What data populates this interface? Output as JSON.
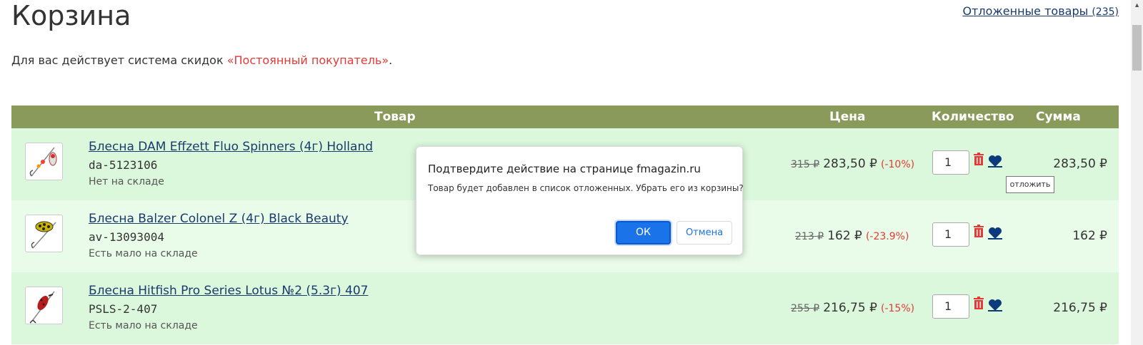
{
  "page": {
    "title": "Корзина",
    "saved_link_label": "Отложенные товары",
    "saved_link_count": "(235)",
    "discount_prefix": "Для вас действует система скидок ",
    "discount_name": "«Постоянный покупатель»",
    "discount_suffix": "."
  },
  "table": {
    "col_product": "Товар",
    "col_price": "Цена",
    "col_quantity": "Количество",
    "col_sum": "Сумма",
    "rows": [
      {
        "name": "Блесна DAM Effzett Fluo Spinners (4г) Holland",
        "code": "da-5123106",
        "stock": "Нет на складе",
        "old_price": "315 ₽",
        "price": "283,50 ₽",
        "discount": "(-10%)",
        "qty": "1",
        "sum": "283,50 ₽"
      },
      {
        "name": "Блесна Balzer Colonel Z (4г) Black Beauty",
        "code": "av-13093004",
        "stock": "Есть мало на складе",
        "old_price": "213 ₽",
        "price": "162 ₽",
        "discount": "(-23.9%)",
        "qty": "1",
        "sum": "162 ₽"
      },
      {
        "name": "Блесна Hitfish Pro Series Lotus №2 (5.3г) 407",
        "code": "PSLS-2-407",
        "stock": "Есть мало на складе",
        "old_price": "255 ₽",
        "price": "216,75 ₽",
        "discount": "(-15%)",
        "qty": "1",
        "sum": "216,75 ₽"
      }
    ]
  },
  "tooltip": {
    "text": "отложить"
  },
  "dialog": {
    "title": "Подтвердите действие на странице fmagazin.ru",
    "message": "Товар будет добавлен в список отложенных. Убрать его из корзины?",
    "ok_label": "ОК",
    "cancel_label": "Отмена"
  },
  "colors": {
    "header_bg": "#8a9a5b",
    "row_bg": "#dcf8dc",
    "accent_red": "#e53935",
    "link_blue": "#1a3a6e",
    "dialog_button": "#1a73e8"
  },
  "icons": {
    "delete": "trash-icon",
    "save_for_later": "heart-icon"
  }
}
